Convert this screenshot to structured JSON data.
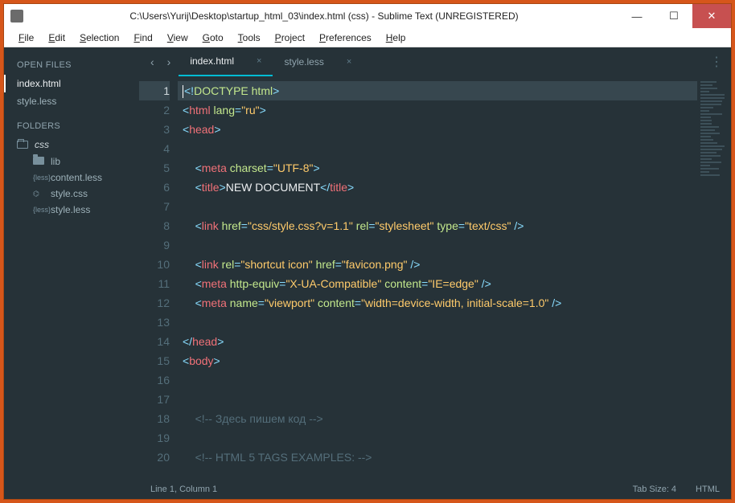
{
  "title": "C:\\Users\\Yurij\\Desktop\\startup_html_03\\index.html (css) - Sublime Text (UNREGISTERED)",
  "menu": [
    "File",
    "Edit",
    "Selection",
    "Find",
    "View",
    "Goto",
    "Tools",
    "Project",
    "Preferences",
    "Help"
  ],
  "sidebar": {
    "openFilesLabel": "OPEN FILES",
    "openFiles": [
      "index.html",
      "style.less"
    ],
    "foldersLabel": "FOLDERS",
    "root": "css",
    "items": [
      {
        "icon": "folder",
        "label": "lib"
      },
      {
        "icon": "less",
        "label": "content.less"
      },
      {
        "icon": "css",
        "label": "style.css"
      },
      {
        "icon": "less",
        "label": "style.less"
      }
    ]
  },
  "tabs": [
    {
      "label": "index.html",
      "active": true
    },
    {
      "label": "style.less",
      "active": false
    }
  ],
  "status": {
    "left": "Line 1, Column 1",
    "tabSize": "Tab Size: 4",
    "syntax": "HTML"
  },
  "code": {
    "lines": [
      {
        "n": 1,
        "hl": true,
        "tokens": [
          [
            "pun",
            "<!"
          ],
          [
            "doctype",
            "DOCTYPE html"
          ],
          [
            "pun",
            ">"
          ]
        ]
      },
      {
        "n": 2,
        "tokens": [
          [
            "pun",
            "<"
          ],
          [
            "tag",
            "html"
          ],
          [
            "txt",
            " "
          ],
          [
            "attr",
            "lang"
          ],
          [
            "pun",
            "="
          ],
          [
            "str",
            "\"ru\""
          ],
          [
            "pun",
            ">"
          ]
        ]
      },
      {
        "n": 3,
        "tokens": [
          [
            "pun",
            "<"
          ],
          [
            "tag",
            "head"
          ],
          [
            "pun",
            ">"
          ]
        ]
      },
      {
        "n": 4,
        "tokens": []
      },
      {
        "n": 5,
        "indent": 1,
        "tokens": [
          [
            "pun",
            "<"
          ],
          [
            "tag",
            "meta"
          ],
          [
            "txt",
            " "
          ],
          [
            "attr",
            "charset"
          ],
          [
            "pun",
            "="
          ],
          [
            "str",
            "\"UTF-8\""
          ],
          [
            "pun",
            ">"
          ]
        ]
      },
      {
        "n": 6,
        "indent": 1,
        "tokens": [
          [
            "pun",
            "<"
          ],
          [
            "tag",
            "title"
          ],
          [
            "pun",
            ">"
          ],
          [
            "txt",
            "NEW DOCUMENT"
          ],
          [
            "pun",
            "</"
          ],
          [
            "tag",
            "title"
          ],
          [
            "pun",
            ">"
          ]
        ]
      },
      {
        "n": 7,
        "tokens": []
      },
      {
        "n": 8,
        "indent": 1,
        "tokens": [
          [
            "pun",
            "<"
          ],
          [
            "tag",
            "link"
          ],
          [
            "txt",
            " "
          ],
          [
            "attr",
            "href"
          ],
          [
            "pun",
            "="
          ],
          [
            "str",
            "\"css/style.css?v=1.1\""
          ],
          [
            "txt",
            " "
          ],
          [
            "attr",
            "rel"
          ],
          [
            "pun",
            "="
          ],
          [
            "str",
            "\"stylesheet\""
          ],
          [
            "txt",
            " "
          ],
          [
            "attr",
            "type"
          ],
          [
            "pun",
            "="
          ],
          [
            "str",
            "\"text/css\""
          ],
          [
            "txt",
            " "
          ],
          [
            "pun",
            "/>"
          ]
        ]
      },
      {
        "n": 9,
        "tokens": []
      },
      {
        "n": 10,
        "indent": 1,
        "tokens": [
          [
            "pun",
            "<"
          ],
          [
            "tag",
            "link"
          ],
          [
            "txt",
            " "
          ],
          [
            "attr",
            "rel"
          ],
          [
            "pun",
            "="
          ],
          [
            "str",
            "\"shortcut icon\""
          ],
          [
            "txt",
            " "
          ],
          [
            "attr",
            "href"
          ],
          [
            "pun",
            "="
          ],
          [
            "str",
            "\"favicon.png\""
          ],
          [
            "txt",
            " "
          ],
          [
            "pun",
            "/>"
          ]
        ]
      },
      {
        "n": 11,
        "indent": 1,
        "tokens": [
          [
            "pun",
            "<"
          ],
          [
            "tag",
            "meta"
          ],
          [
            "txt",
            " "
          ],
          [
            "attr",
            "http-equiv"
          ],
          [
            "pun",
            "="
          ],
          [
            "str",
            "\"X-UA-Compatible\""
          ],
          [
            "txt",
            " "
          ],
          [
            "attr",
            "content"
          ],
          [
            "pun",
            "="
          ],
          [
            "str",
            "\"IE=edge\""
          ],
          [
            "txt",
            " "
          ],
          [
            "pun",
            "/>"
          ]
        ]
      },
      {
        "n": 12,
        "indent": 1,
        "tokens": [
          [
            "pun",
            "<"
          ],
          [
            "tag",
            "meta"
          ],
          [
            "txt",
            " "
          ],
          [
            "attr",
            "name"
          ],
          [
            "pun",
            "="
          ],
          [
            "str",
            "\"viewport\""
          ],
          [
            "txt",
            " "
          ],
          [
            "attr",
            "content"
          ],
          [
            "pun",
            "="
          ],
          [
            "str",
            "\"width=device-width, initial-scale=1.0\""
          ],
          [
            "txt",
            " "
          ],
          [
            "pun",
            "/>"
          ]
        ]
      },
      {
        "n": 13,
        "tokens": []
      },
      {
        "n": 14,
        "tokens": [
          [
            "pun",
            "</"
          ],
          [
            "tag",
            "head"
          ],
          [
            "pun",
            ">"
          ]
        ]
      },
      {
        "n": 15,
        "tokens": [
          [
            "pun",
            "<"
          ],
          [
            "tag",
            "body"
          ],
          [
            "pun",
            ">"
          ]
        ]
      },
      {
        "n": 16,
        "tokens": []
      },
      {
        "n": 17,
        "tokens": []
      },
      {
        "n": 18,
        "indent": 1,
        "tokens": [
          [
            "cmt",
            "<!-- Здесь пишем код -->"
          ]
        ]
      },
      {
        "n": 19,
        "tokens": []
      },
      {
        "n": 20,
        "indent": 1,
        "tokens": [
          [
            "cmt",
            "<!-- HTML 5 TAGS EXAMPLES: -->"
          ]
        ]
      }
    ]
  }
}
